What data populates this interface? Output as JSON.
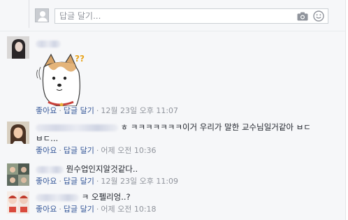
{
  "reply_box": {
    "placeholder": "답글 달기..."
  },
  "comments": [
    {
      "text": "",
      "like_label": "좋아요",
      "reply_label": "답글 달기",
      "timestamp": "12월 23일 오후 11:07",
      "has_sticker": true,
      "sticker_text": "??"
    },
    {
      "text": "ㅎ ㅋㅋㅋㅋㅋㅋㅋ이거 우리가 말한 교수님일거같아 ㅂㄷ",
      "text_line2": "ㅂㄷ...",
      "like_label": "좋아요",
      "reply_label": "답글 달기",
      "timestamp": "어제 오전 10:36"
    },
    {
      "text": "뭔수업인지알것같다..",
      "like_label": "좋아요",
      "reply_label": "답글 달기",
      "timestamp": "12월 23일 오후 11:09"
    },
    {
      "text": "ㅋ 오펠리엉..?",
      "like_label": "좋아요",
      "reply_label": "답글 달기",
      "timestamp": "어제 오전 10:18"
    }
  ],
  "colors": {
    "link": "#365899",
    "meta": "#90949c",
    "background": "#f6f7f9"
  }
}
